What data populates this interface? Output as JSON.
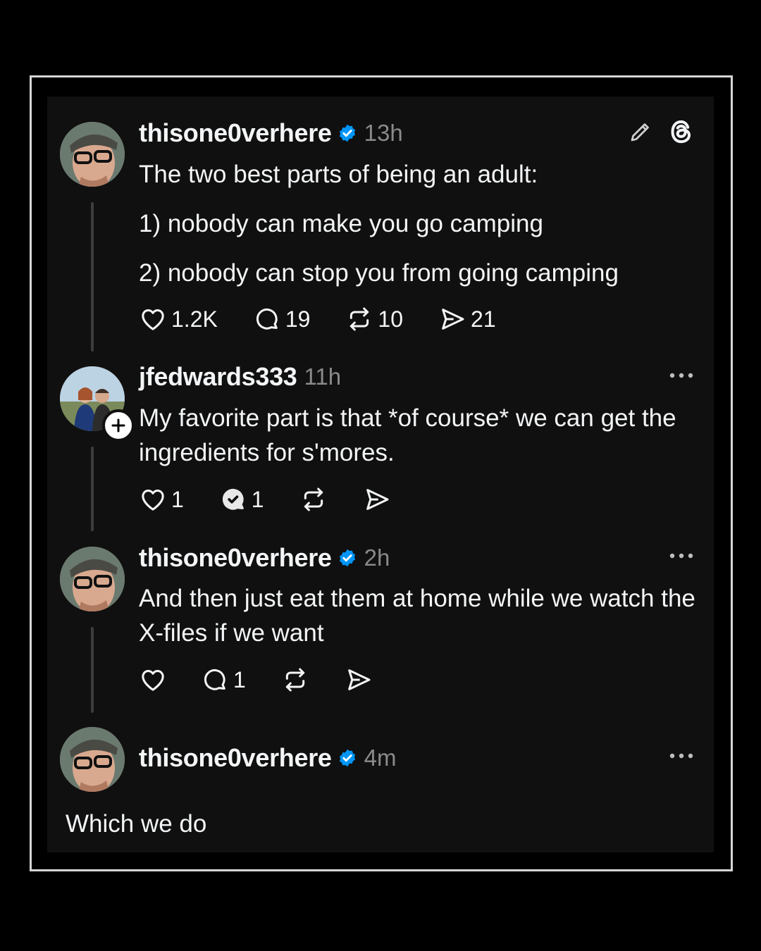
{
  "posts": [
    {
      "username": "thisone0verhere",
      "verified": true,
      "time": "13h",
      "paragraphs": [
        "The two best parts of being an adult:",
        "1) nobody can make you go camping",
        "2) nobody can stop you from going camping"
      ],
      "likes": "1.2K",
      "replies": "19",
      "reposts": "10",
      "shares": "21"
    },
    {
      "username": "jfedwards333",
      "verified": false,
      "time": "11h",
      "text": "My favorite part is that *of course* we can get the ingredients for s'mores.",
      "likes": "1",
      "replies": "1"
    },
    {
      "username": "thisone0verhere",
      "verified": true,
      "time": "2h",
      "text": "And then just eat them at home while we watch the X-files if we want",
      "replies": "1"
    },
    {
      "username": "thisone0verhere",
      "verified": true,
      "time": "4m",
      "text": "Which we do"
    }
  ],
  "colors": {
    "background": "#000000",
    "card": "#101010",
    "text": "#f3f5f7",
    "muted": "#8a8a8a",
    "verified": "#0095f6",
    "thread_line": "#3d3d3d"
  },
  "icons": [
    "edit-icon",
    "threads-logo-icon",
    "heart-icon",
    "reply-icon",
    "repost-icon",
    "share-icon",
    "more-icon",
    "verified-icon",
    "follow-plus-icon"
  ]
}
